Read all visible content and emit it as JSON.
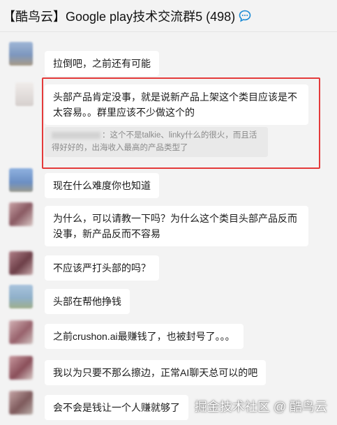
{
  "header": {
    "title": "【酷鸟云】Google play技术交流群5 (498)",
    "icon": "chat-bubble-icon",
    "accent": "#1a8ad4"
  },
  "messages": [
    {
      "text": "拉倒吧，之前还有可能"
    },
    {
      "text": "头部产品肯定没事，就是说新产品上架这个类目应该是不太容易。。群里应该不少做这个的",
      "quote": "：这个不是talkie、linky什么的很火，而且活得好好的，出海收入最高的产品类型了"
    },
    {
      "text": "现在什么难度你也知道"
    },
    {
      "text": "为什么，可以请教一下吗？为什么这个类目头部产品反而没事，新产品反而不容易"
    },
    {
      "text": "不应该严打头部的吗？"
    },
    {
      "text": "头部在帮他挣钱"
    },
    {
      "text": "之前crushon.ai最赚钱了，也被封号了。。。"
    },
    {
      "text": "我以为只要不那么擦边，正常AI聊天总可以的吧"
    },
    {
      "text": "会不会是钱让一个人赚就够了"
    }
  ],
  "highlight_color": "#e43a3a",
  "watermark": "掘金技术社区 @ 酷鸟云"
}
